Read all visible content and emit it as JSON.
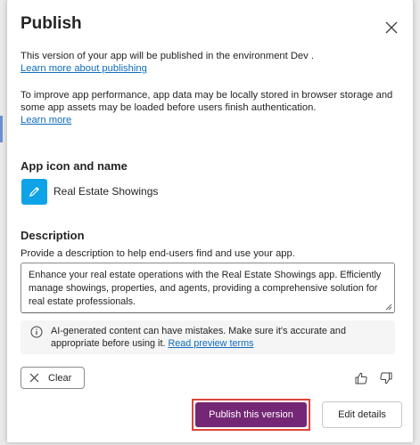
{
  "dialog": {
    "title": "Publish",
    "env_text": "This version of your app will be published in the environment Dev .",
    "learn_publishing": "Learn more about publishing",
    "storage_text": "To improve app performance, app data may be locally stored in browser storage and some app assets may be loaded before users finish authentication.",
    "learn_more": "Learn more"
  },
  "app_section": {
    "heading": "App icon and name",
    "app_name": "Real Estate Showings",
    "icon": "pencil-icon",
    "icon_color": "#0ea3e6"
  },
  "description": {
    "heading": "Description",
    "helper": "Provide a description to help end-users find and use your app.",
    "value": "Enhance your real estate operations with the Real Estate Showings app. Efficiently manage showings, properties, and agents, providing a comprehensive solution for real estate professionals."
  },
  "notice": {
    "text": "AI-generated content can have mistakes. Make sure it's accurate and appropriate before using it.",
    "link": "Read preview terms"
  },
  "actions": {
    "clear": "Clear",
    "publish": "Publish this version",
    "edit_details": "Edit details"
  },
  "colors": {
    "primary": "#742774",
    "link": "#0f6cbd",
    "highlight": "#e0443b"
  }
}
